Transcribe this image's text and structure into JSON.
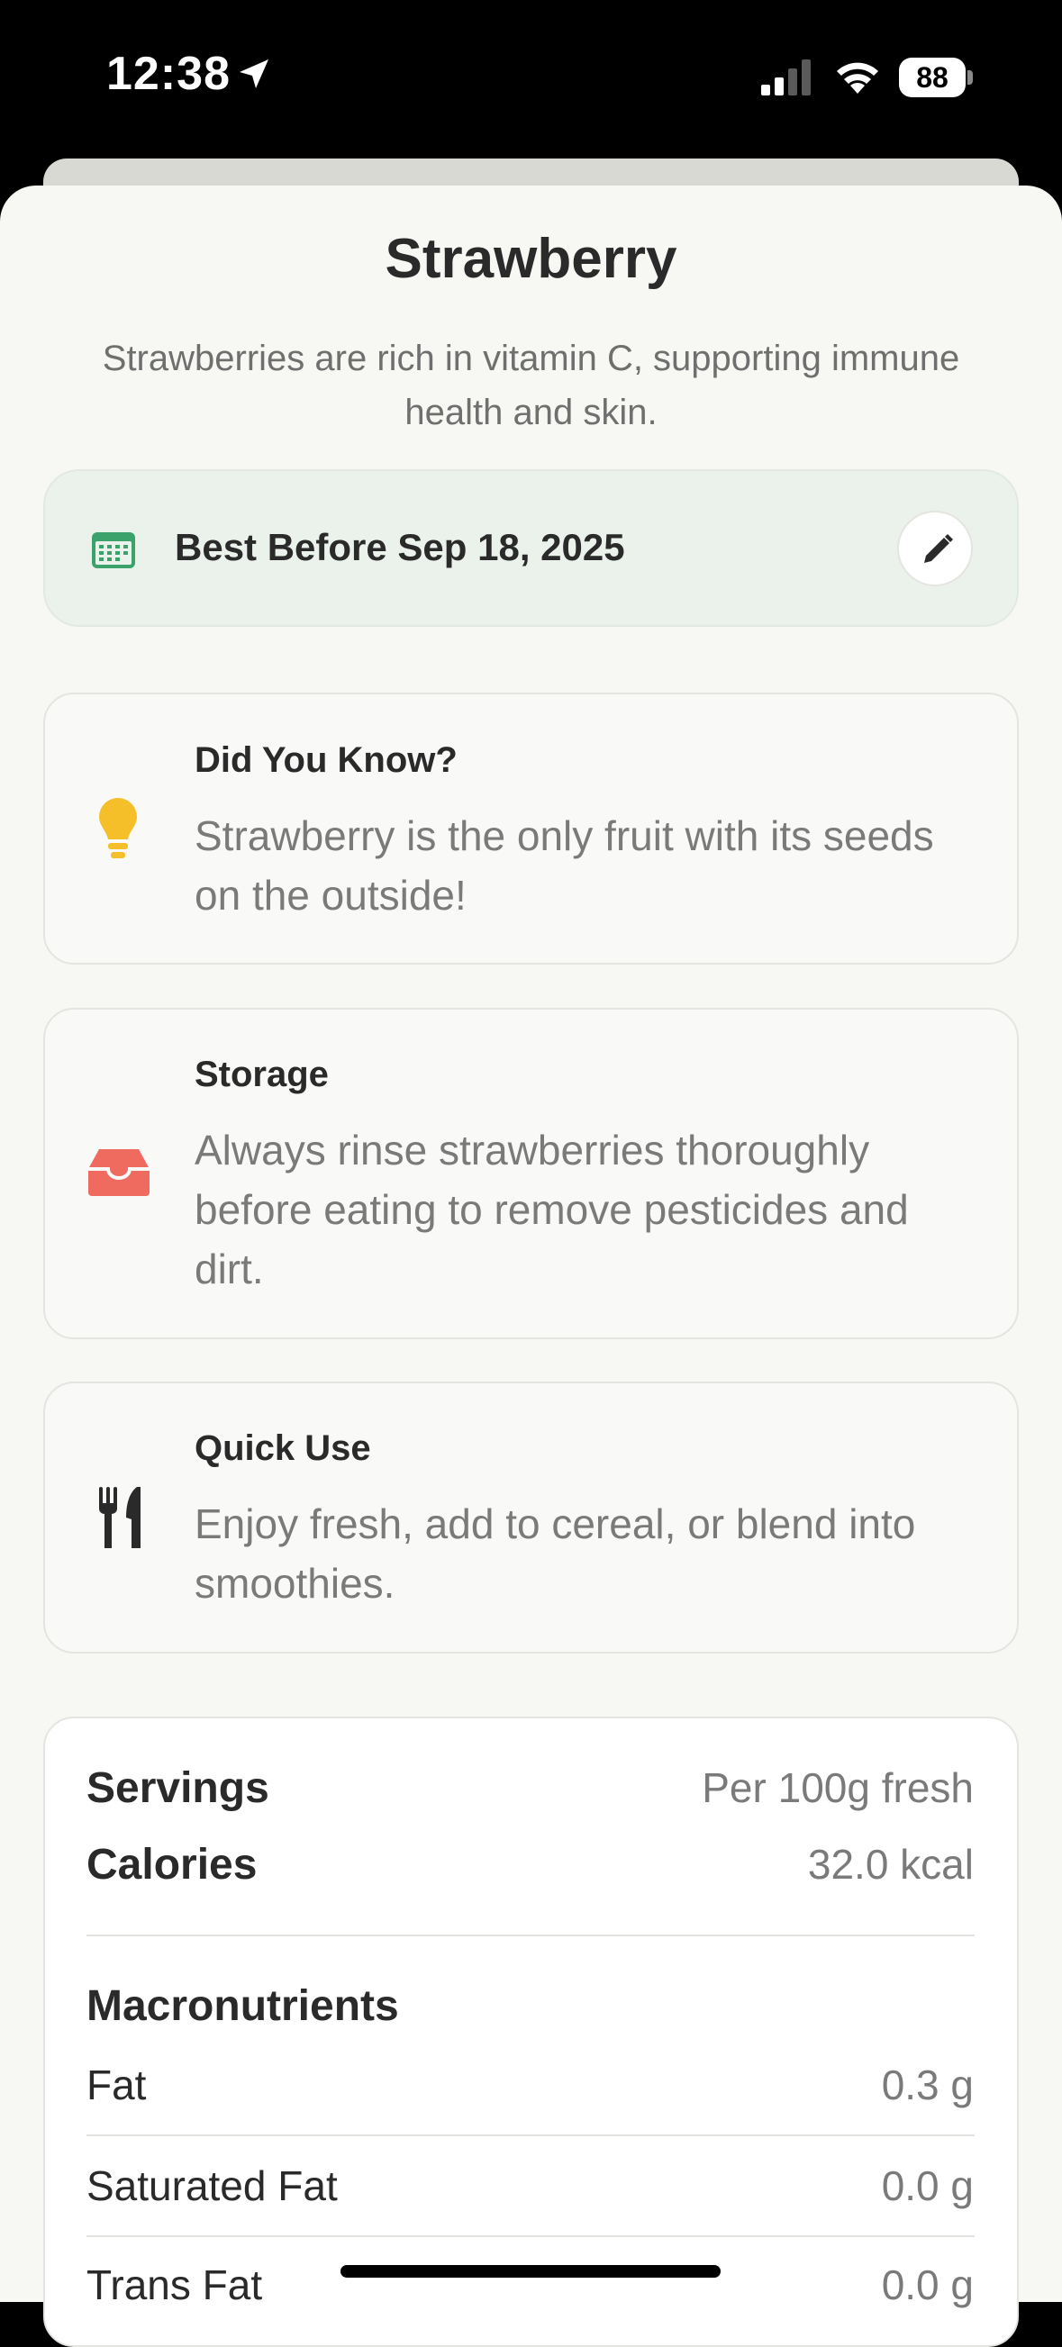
{
  "status_bar": {
    "time": "12:38",
    "battery": "88"
  },
  "food": {
    "title": "Strawberry",
    "subtitle": "Strawberries are rich in vitamin C, supporting immune health and skin."
  },
  "best_before": {
    "label": "Best Before Sep 18, 2025"
  },
  "cards": [
    {
      "icon": "lightbulb-icon",
      "title": "Did You Know?",
      "body": "Strawberry is the only fruit with its seeds on the outside!"
    },
    {
      "icon": "tray-icon",
      "title": "Storage",
      "body": "Always rinse strawberries thoroughly before eating to remove pesticides and dirt."
    },
    {
      "icon": "fork-knife-icon",
      "title": "Quick Use",
      "body": "Enjoy fresh, add to cereal, or blend into smoothies."
    }
  ],
  "nutrition": {
    "servings_label": "Servings",
    "servings_value": "Per 100g fresh",
    "calories_label": "Calories",
    "calories_value": "32.0 kcal",
    "macros_heading": "Macronutrients",
    "rows": [
      {
        "label": "Fat",
        "value": "0.3 g"
      },
      {
        "label": "Saturated Fat",
        "value": "0.0 g"
      },
      {
        "label": "Trans Fat",
        "value": "0.0 g"
      }
    ]
  },
  "colors": {
    "accent_green": "#3aa26a",
    "lightbulb": "#f5bf2a",
    "tray": "#ef6a5f",
    "best_before_bg": "#ebf2ec"
  }
}
